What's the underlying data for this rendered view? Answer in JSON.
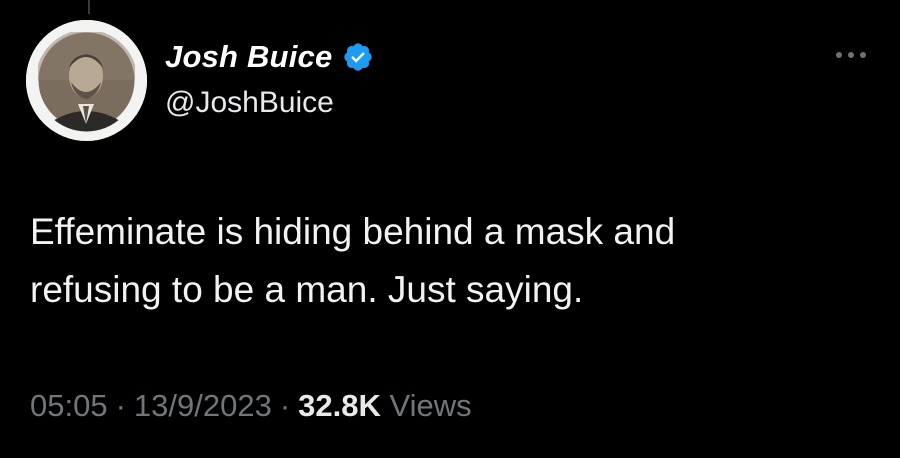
{
  "author": {
    "name": "Josh Buice",
    "handle": "@JoshBuice",
    "verified": true,
    "verified_color": "#1d9bf0"
  },
  "tweet": {
    "lines": [
      "Effeminate is hiding behind a mask and",
      "refusing to be a man. Just saying."
    ]
  },
  "meta": {
    "time": "05:05",
    "separator": "·",
    "date": "13/9/2023",
    "views_count": "32.8K",
    "views_label": "Views"
  },
  "icons": {
    "more": "more-icon",
    "verified": "verified-badge-icon"
  }
}
